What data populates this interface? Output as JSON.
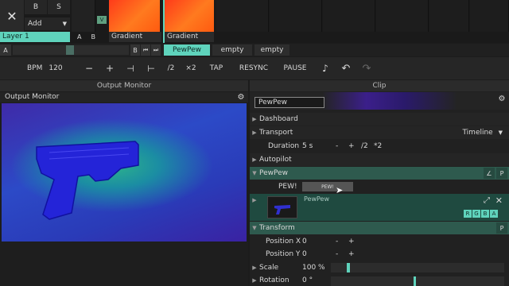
{
  "layer": {
    "buttons": {
      "s_label": "S",
      "b_label": "B",
      "add_label": "Add",
      "a_label": "A",
      "b2_label": "B",
      "v_label": "V"
    },
    "name": "Layer 1",
    "clips": [
      {
        "name": "Gradient",
        "a": "A",
        "b": "B"
      },
      {
        "name": "Gradient"
      }
    ]
  },
  "deck": {
    "a_label": "A",
    "b_label": "B",
    "tabs": [
      "PewPew",
      "empty",
      "empty"
    ]
  },
  "toolbar": {
    "bpm_label": "BPM",
    "bpm_value": "120",
    "minus": "−",
    "plus": "+",
    "div2": "/2",
    "x2": "×2",
    "tap": "TAP",
    "resync": "RESYNC",
    "pause": "PAUSE"
  },
  "output_monitor": {
    "panel_title": "Output Monitor",
    "header_label": "Output Monitor"
  },
  "clip_panel": {
    "panel_title": "Clip",
    "name_value": "PewPew",
    "sections": {
      "dashboard": "Dashboard",
      "transport": "Transport",
      "transport_mode": "Timeline",
      "duration_label": "Duration",
      "duration_value": "5 s",
      "duration_ops": [
        "-",
        "+",
        "/2",
        "*2"
      ],
      "autopilot": "Autopilot",
      "effect_name": "PewPew",
      "pew_label": "PEW!",
      "pew_button": "PEW!",
      "source_name": "PewPew",
      "rgba": [
        "R",
        "G",
        "B",
        "A"
      ],
      "transform": "Transform",
      "position_x_label": "Position X",
      "position_x_value": "0",
      "position_y_label": "Position Y",
      "position_y_value": "0",
      "scale_label": "Scale",
      "scale_value": "100 %",
      "rotation_label": "Rotation",
      "rotation_value": "0 °",
      "ops": [
        "-",
        "+"
      ],
      "p_badge": "P"
    }
  },
  "colors": {
    "accent": "#5fd3bc",
    "panel": "#262626",
    "effect_bar": "#2e5a4e"
  }
}
